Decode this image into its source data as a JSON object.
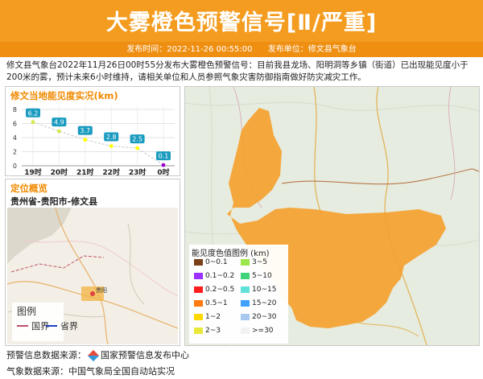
{
  "header": {
    "title": "大雾橙色预警信号[Ⅱ/严重]",
    "publish_time": "发布时间：2022-11-26 00:55:00",
    "publisher": "发布单位：修文县气象台"
  },
  "description": "修文县气象台2022年11月26日00时55分发布大雾橙色预警信号：目前我县龙场、阳明洞等乡镇（街道）已出现能见度小于200米的雾，预计未来6小时维持，请相关单位和人员参照气象灾害防御指南做好防灾减灾工作。",
  "visibility_panel": {
    "title": "修文当地能见度实况(km)"
  },
  "chart_data": {
    "type": "line",
    "categories": [
      "19时",
      "20时",
      "21时",
      "22时",
      "23时",
      "0时"
    ],
    "values": [
      6.2,
      4.9,
      3.7,
      2.8,
      2.5,
      0.1
    ],
    "value_labels": [
      "6.2",
      "4.9",
      "3.7",
      "2.8",
      "2.5",
      "0.1"
    ],
    "y_ticks": [
      "0",
      "2",
      "4",
      "6",
      "8"
    ],
    "ylim": [
      0,
      8
    ],
    "point_colors": [
      "#d6e84a",
      "#d6e84a",
      "#ffff00",
      "#ffff00",
      "#ffff00",
      "#9900cc"
    ],
    "label_color": "#1a9bbf",
    "grid": true
  },
  "location_panel": {
    "title": "定位概览",
    "region": "贵州省-贵阳市-修文县",
    "map_city_label": "贵阳",
    "legend": {
      "title": "图例",
      "national": "国界",
      "provincial": "省界",
      "national_color": "#c0506a",
      "provincial_color": "#1f3fc8"
    }
  },
  "vis_legend": {
    "title": "能见度色值图例 (km)",
    "items": [
      {
        "label": "0~0.1",
        "color": "#7b3f1a"
      },
      {
        "label": "3~5",
        "color": "#9be64a"
      },
      {
        "label": "0.1~0.2",
        "color": "#9b30ff"
      },
      {
        "label": "5~10",
        "color": "#3fd47a"
      },
      {
        "label": "0.2~0.5",
        "color": "#ff1e1e"
      },
      {
        "label": "10~15",
        "color": "#5fe0d8"
      },
      {
        "label": "0.5~1",
        "color": "#ff7a10"
      },
      {
        "label": "15~20",
        "color": "#3fa0ff"
      },
      {
        "label": "1~2",
        "color": "#ffd700"
      },
      {
        "label": "20~30",
        "color": "#a8c8f0"
      },
      {
        "label": "2~3",
        "color": "#e8e83a"
      },
      {
        "label": ">=30",
        "color": "#f2f2f2"
      }
    ]
  },
  "warning_area_color": "#f5a12f",
  "footer": {
    "warning_source": "预警信息数据来源：",
    "warning_source_name": "国家预警信息发布中心",
    "weather_source": "气象数据来源：中国气象局全国自动站实况"
  }
}
